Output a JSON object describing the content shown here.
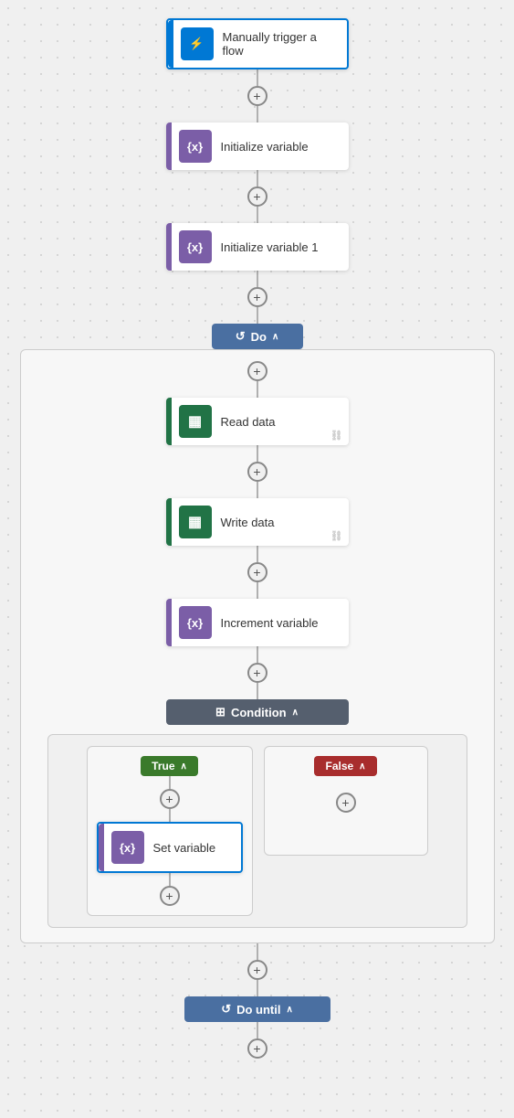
{
  "flow": {
    "trigger": {
      "label": "Manually trigger a flow",
      "icon": "lightning",
      "accent_color": "#0078d4",
      "icon_bg": "#0078d4"
    },
    "steps": [
      {
        "id": "init-var",
        "label": "Initialize variable",
        "icon": "fx",
        "accent_color": "#7b5ea7",
        "icon_bg": "#7b5ea7"
      },
      {
        "id": "init-var-1",
        "label": "Initialize variable 1",
        "icon": "fx",
        "accent_color": "#7b5ea7",
        "icon_bg": "#7b5ea7"
      }
    ],
    "do_block": {
      "label": "Do",
      "chevron": "∧",
      "steps": [
        {
          "id": "read-data",
          "label": "Read data",
          "icon": "excel",
          "accent_color": "#217346",
          "icon_bg": "#217346",
          "has_link": true
        },
        {
          "id": "write-data",
          "label": "Write data",
          "icon": "excel",
          "accent_color": "#217346",
          "icon_bg": "#217346",
          "has_link": true
        },
        {
          "id": "increment-variable",
          "label": "Increment variable",
          "icon": "fx",
          "accent_color": "#7b5ea7",
          "icon_bg": "#7b5ea7"
        }
      ],
      "condition": {
        "label": "Condition",
        "chevron": "∧",
        "true_branch": {
          "label": "True",
          "chevron": "∧",
          "steps": [
            {
              "id": "set-variable",
              "label": "Set variable",
              "icon": "fx",
              "accent_color": "#7b5ea7",
              "icon_bg": "#7b5ea7",
              "selected": true
            }
          ]
        },
        "false_branch": {
          "label": "False",
          "chevron": "∧",
          "steps": []
        }
      }
    },
    "do_until": {
      "label": "Do until",
      "chevron": "∧"
    }
  },
  "icons": {
    "plus": "+",
    "chevron_up": "∧",
    "lightning": "⚡",
    "fx": "{x}",
    "excel": "▦",
    "loop": "↺",
    "condition": "⊞",
    "link": "🔗"
  }
}
